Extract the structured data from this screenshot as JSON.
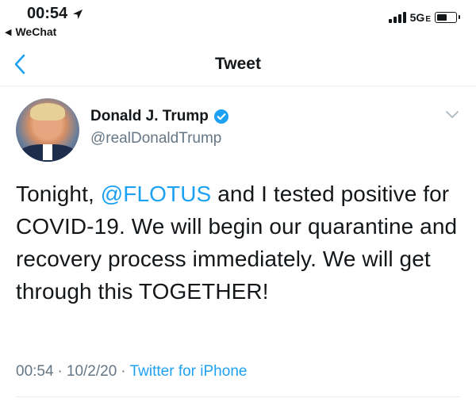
{
  "status_bar": {
    "time": "00:54",
    "back_app": "WeChat",
    "network": "5G",
    "network_suffix": "E"
  },
  "nav": {
    "title": "Tweet"
  },
  "tweet": {
    "author": {
      "display_name": "Donald J. Trump",
      "handle": "@realDonaldTrump",
      "verified": true
    },
    "text": {
      "part1": "Tonight, ",
      "mention": "@FLOTUS",
      "part2": " and I tested positive for COVID-19. We will begin our quarantine and recovery process immediately. We will get through this TOGETHER!"
    },
    "meta": {
      "time": "00:54",
      "date": "10/2/20",
      "separator": "·",
      "source": "Twitter for iPhone"
    }
  },
  "colors": {
    "accent": "#1da1f2",
    "text": "#14171a",
    "secondary": "#657786",
    "divider": "#e6ecf0"
  },
  "icons": [
    "location-arrow-icon",
    "back-triangle-icon",
    "signal-icon",
    "battery-icon",
    "back-chevron-icon",
    "verified-badge-icon",
    "caret-down-icon"
  ]
}
